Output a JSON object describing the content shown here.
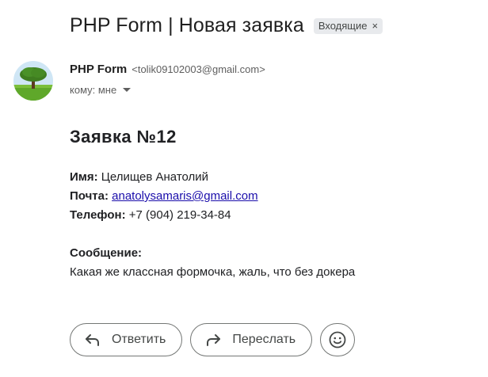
{
  "subject": "PHP Form | Новая заявка",
  "label_chip": {
    "text": "Входящие",
    "close": "×"
  },
  "sender": {
    "name": "PHP Form",
    "email": "<tolik09102003@gmail.com>",
    "to_text": "кому: мне"
  },
  "message": {
    "heading": "Заявка №12",
    "name_label": "Имя:",
    "name_value": "Целищев Анатолий",
    "mail_label": "Почта:",
    "mail_value": "anatolysamaris@gmail.com",
    "phone_label": "Телефон:",
    "phone_value": "+7 (904) 219-34-84",
    "msg_label": "Сообщение:",
    "msg_text": "Какая же классная формочка, жаль, что без докера"
  },
  "actions": {
    "reply": "Ответить",
    "forward": "Переслать"
  },
  "icons": {
    "avatar": "tree-avatar-icon",
    "reply": "reply-arrow-icon",
    "forward": "forward-arrow-icon",
    "emoji": "smiley-icon"
  }
}
